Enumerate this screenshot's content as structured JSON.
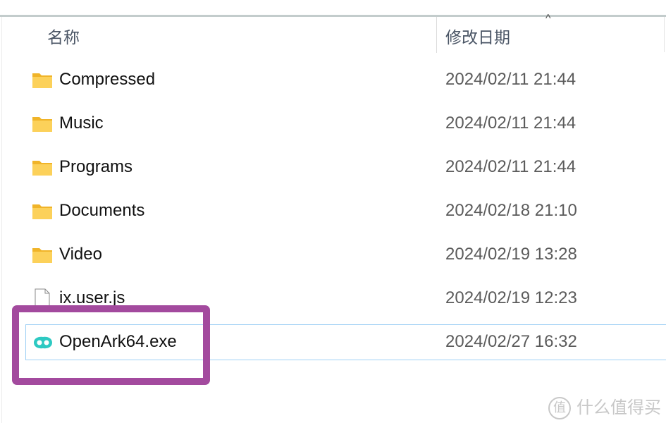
{
  "header": {
    "name_col": "名称",
    "date_col": "修改日期",
    "sort_icon": "chevron-up-icon"
  },
  "files": [
    {
      "name": "Compressed",
      "date": "2024/02/11 21:44",
      "icon": "folder-icon"
    },
    {
      "name": "Music",
      "date": "2024/02/11 21:44",
      "icon": "folder-icon"
    },
    {
      "name": "Programs",
      "date": "2024/02/11 21:44",
      "icon": "folder-icon"
    },
    {
      "name": "Documents",
      "date": "2024/02/18 21:10",
      "icon": "folder-icon"
    },
    {
      "name": "Video",
      "date": "2024/02/19 13:28",
      "icon": "folder-icon"
    },
    {
      "name": "ix.user.js",
      "date": "2024/02/19 12:23",
      "icon": "file-icon"
    },
    {
      "name": "OpenArk64.exe",
      "date": "2024/02/27 16:32",
      "icon": "openark-icon",
      "selected": true
    }
  ],
  "highlight_color": "#a34a9e",
  "watermark": {
    "badge": "值",
    "text": "什么值得买"
  }
}
